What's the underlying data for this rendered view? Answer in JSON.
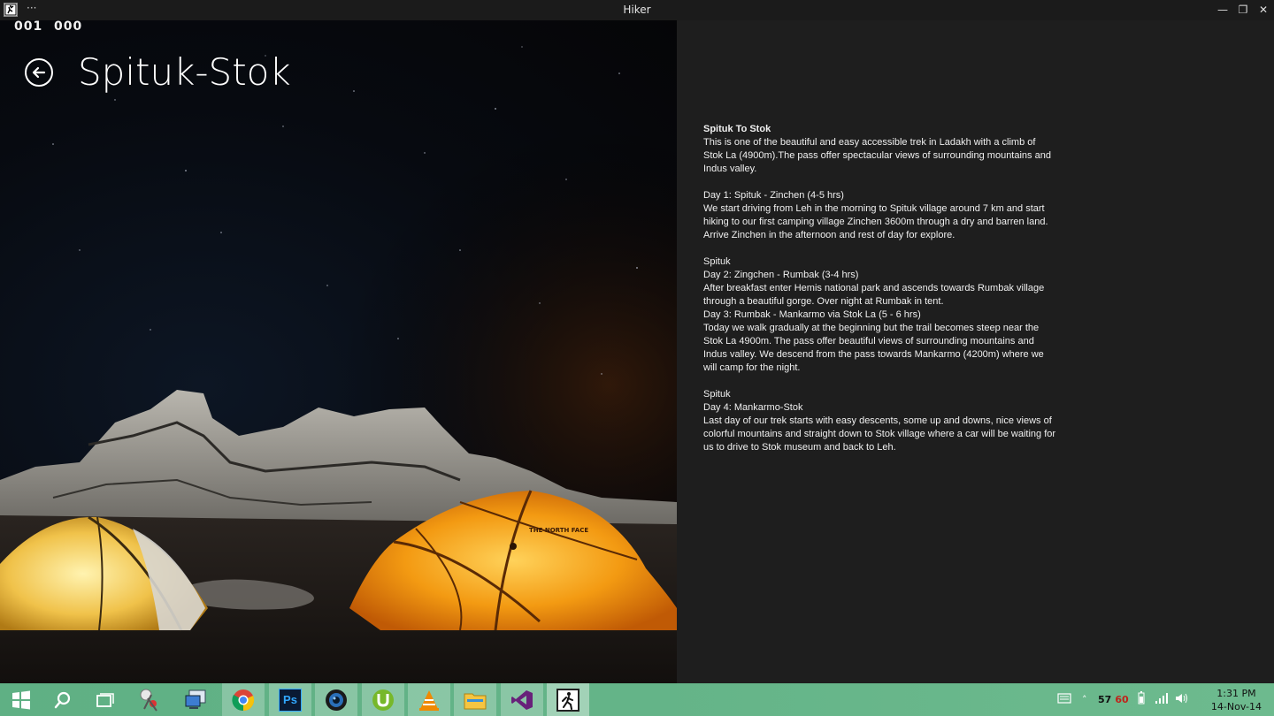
{
  "window": {
    "title": "Hiker",
    "menu_glyph": "···",
    "minimize_glyph": "—",
    "restore_glyph": "❐",
    "close_glyph": "✕"
  },
  "counters": {
    "left": "001",
    "right": "000"
  },
  "page": {
    "title": "Spituk-Stok"
  },
  "description": {
    "heading": "Spituk To Stok",
    "intro": "This is one of the beautiful and easy accessible trek in Ladakh with a climb of Stok La (4900m).The pass offer spectacular views of surrounding mountains and Indus valley.",
    "day1_title": "Day 1: Spituk - Zinchen (4-5 hrs)",
    "day1_text": "We start driving from Leh in the morning to Spituk village around 7 km and start hiking to our first camping village Zinchen 3600m through a dry and barren land. Arrive Zinchen in the afternoon and rest of day for explore.",
    "section2_label": "Spituk",
    "day2_title": "Day 2: Zingchen - Rumbak (3-4 hrs)",
    "day2_text": "After breakfast enter Hemis national park and ascends towards Rumbak village through a beautiful gorge. Over night at Rumbak in tent.",
    "day3_title": "Day 3: Rumbak - Mankarmo via Stok La (5 - 6 hrs)",
    "day3_text": "Today we walk gradually at the beginning but the trail becomes steep near the Stok La 4900m. The pass offer beautiful views of surrounding mountains and Indus valley. We descend from the pass towards Mankarmo (4200m) where we will camp for the night.",
    "section3_label": "Spituk",
    "day4_title": "Day 4: Mankarmo-Stok",
    "day4_text": "Last day of our trek starts with easy descents, some up and downs, nice views of colorful mountains and straight down to Stok village where a car will be waiting for us to drive to Stok museum and back to Leh."
  },
  "hero": {
    "tent_brand": "THE NORTH FACE"
  },
  "taskbar": {
    "items": [
      "start-icon",
      "search-icon",
      "task-view-icon",
      "snipping-tool-icon",
      "remote-desktop-icon",
      "chrome-icon",
      "photoshop-icon",
      "camera-icon",
      "utorrent-icon",
      "vlc-icon",
      "file-explorer-icon",
      "visual-studio-icon",
      "hiker-app-icon"
    ],
    "photoshop_label": "Ps",
    "tray_up_arrow": "˄",
    "tray_num1": "57",
    "tray_num2": "60",
    "time": "1:31 PM",
    "date": "14-Nov-14"
  },
  "colors": {
    "accent_green": "#64b488",
    "pane_bg": "#1e1e1e",
    "tent_orange": "#f39a12"
  }
}
